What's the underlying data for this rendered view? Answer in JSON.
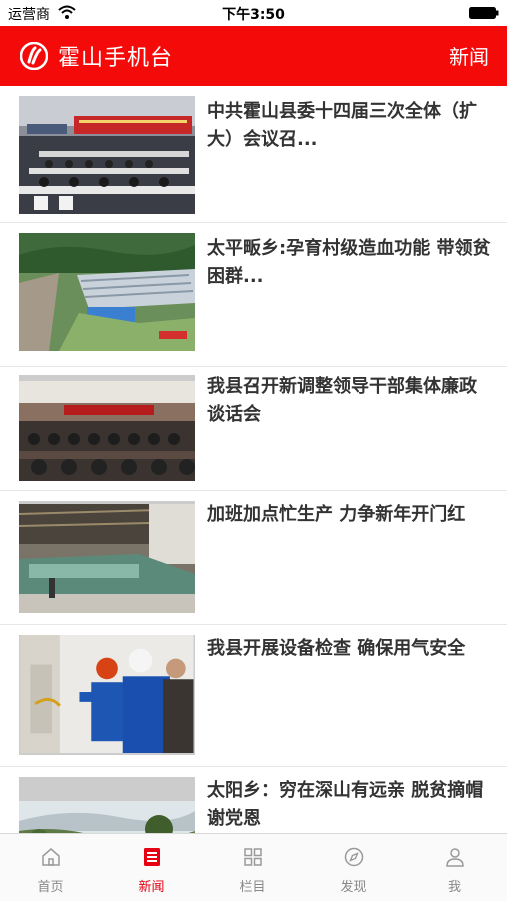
{
  "status_bar": {
    "carrier": "运营商",
    "time": "下午3:50"
  },
  "header": {
    "app_title": "霍山手机台",
    "section_label": "新闻"
  },
  "news": [
    {
      "headline": "中共霍山县委十四届三次全体（扩大）会议召..."
    },
    {
      "headline": "太平畈乡:孕育村级造血功能 带领贫困群..."
    },
    {
      "headline": "我县召开新调整领导干部集体廉政谈话会"
    },
    {
      "headline": "加班加点忙生产 力争新年开门红"
    },
    {
      "headline": "我县开展设备检查 确保用气安全"
    },
    {
      "headline": "太阳乡：穷在深山有远亲 脱贫摘帽谢党恩"
    }
  ],
  "tabs": [
    {
      "label": "首页",
      "icon": "home-icon"
    },
    {
      "label": "新闻",
      "icon": "news-icon",
      "active": true
    },
    {
      "label": "栏目",
      "icon": "grid-icon"
    },
    {
      "label": "发现",
      "icon": "compass-icon"
    },
    {
      "label": "我",
      "icon": "person-icon"
    }
  ],
  "colors": {
    "brand": "#f50a0a",
    "active_tab": "#e60012",
    "inactive_tab": "#888888"
  }
}
